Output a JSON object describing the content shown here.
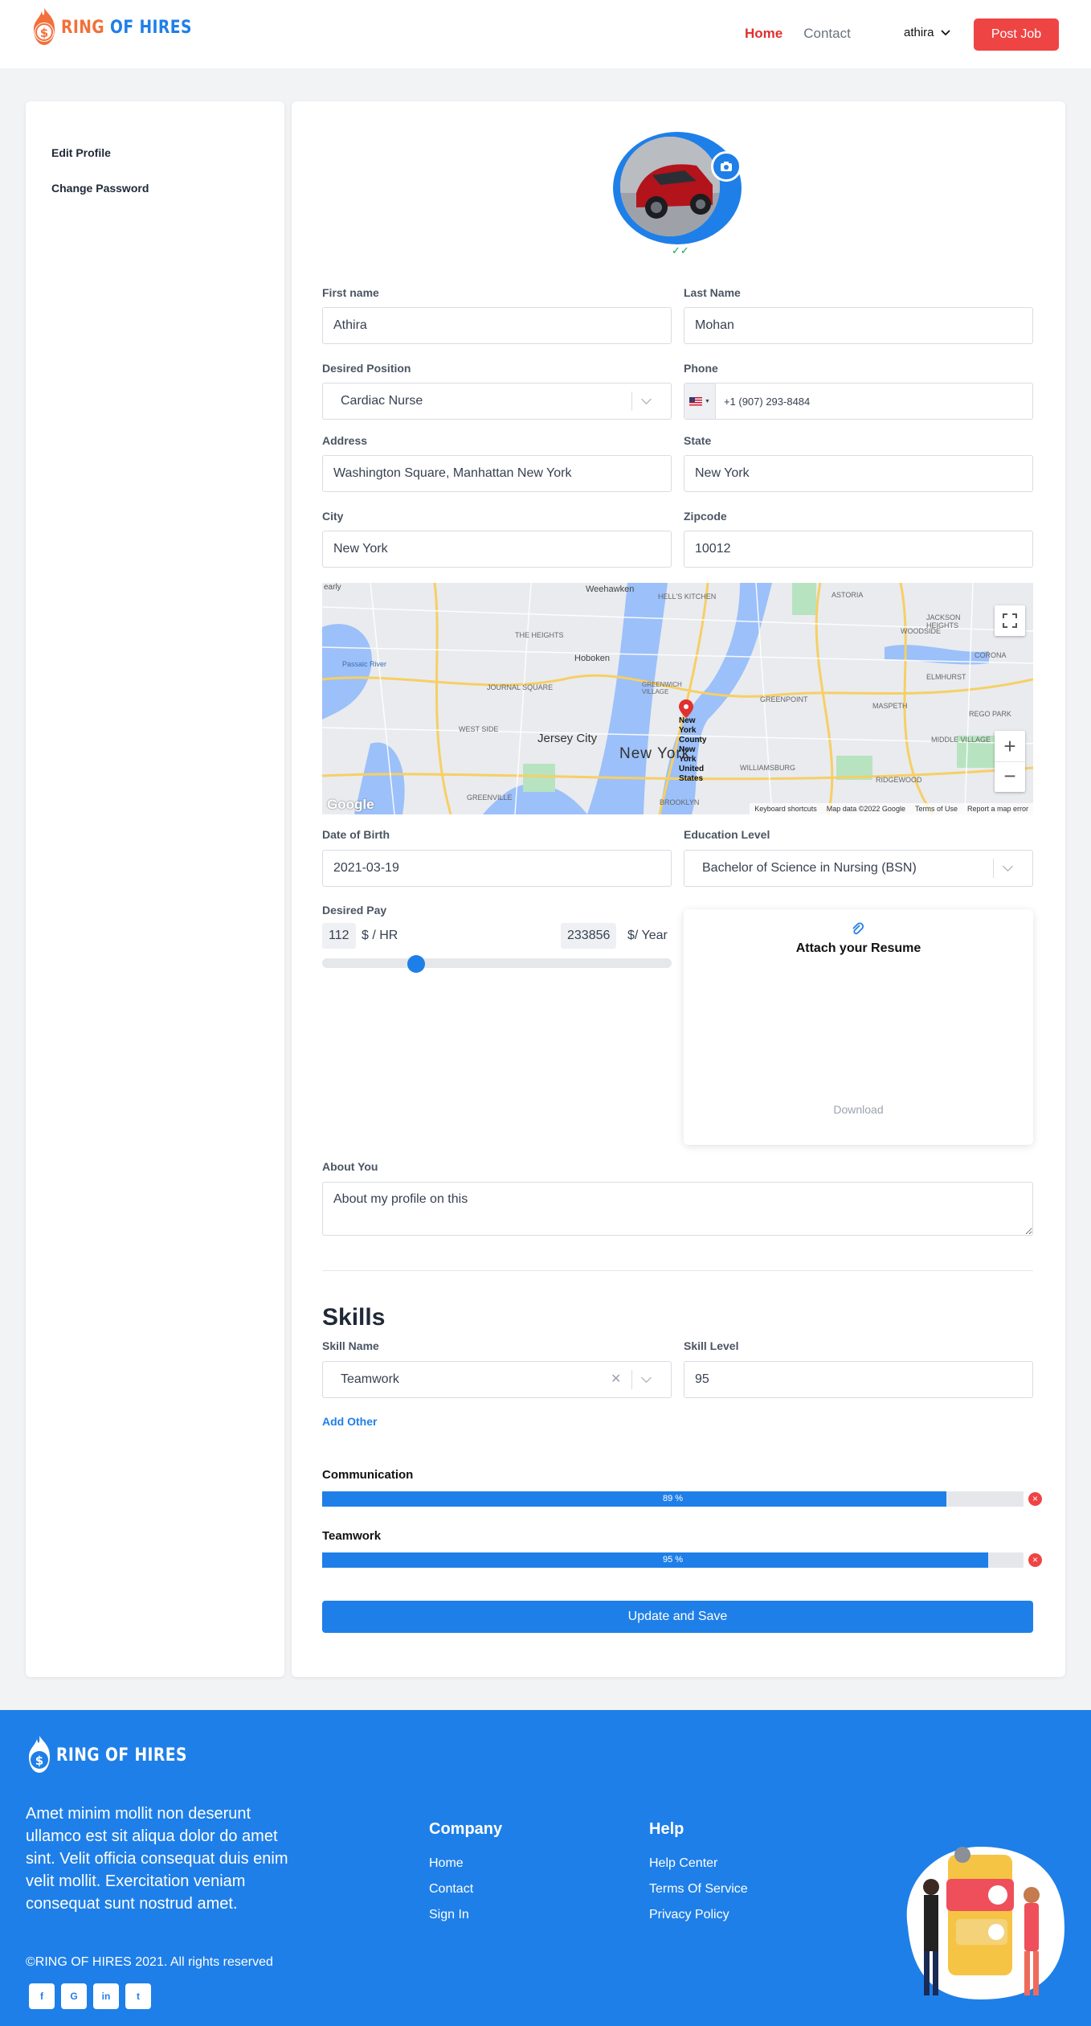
{
  "brand": {
    "name_part1": "RING",
    "name_part2": "OF HIRES"
  },
  "nav": {
    "home": "Home",
    "contact": "Contact",
    "user": "athira",
    "post_job": "Post Job"
  },
  "sidebar": {
    "items": [
      {
        "label": "Edit Profile"
      },
      {
        "label": "Change Password"
      }
    ]
  },
  "form": {
    "first_name": {
      "label": "First name",
      "value": "Athira"
    },
    "last_name": {
      "label": "Last Name",
      "value": "Mohan"
    },
    "position": {
      "label": "Desired Position",
      "value": "Cardiac Nurse"
    },
    "phone": {
      "label": "Phone",
      "value": "+1 (907) 293-8484"
    },
    "address": {
      "label": "Address",
      "value": "Washington Square, Manhattan New York"
    },
    "state": {
      "label": "State",
      "value": "New York"
    },
    "city": {
      "label": "City",
      "value": "New York"
    },
    "zipcode": {
      "label": "Zipcode",
      "value": "10012"
    },
    "dob": {
      "label": "Date of Birth",
      "value": "2021-03-19"
    },
    "education": {
      "label": "Education Level",
      "value": "Bachelor of Science in Nursing (BSN)"
    },
    "pay": {
      "label": "Desired Pay",
      "hourly": "112",
      "hourly_unit": "$ / HR",
      "yearly": "233856",
      "yearly_unit": "$/ Year",
      "slider_fraction": 0.27
    },
    "resume": {
      "title": "Attach your Resume",
      "download": "Download"
    },
    "about": {
      "label": "About You",
      "value": "About my profile on this"
    }
  },
  "map": {
    "labels": {
      "weehawken": "Weehawken",
      "hells_kitchen": "HELL'S KITCHEN",
      "astoria": "ASTORIA",
      "jackson_heights": "JACKSON HEIGHTS",
      "heights": "THE HEIGHTS",
      "hoboken": "Hoboken",
      "woodside": "WOODSIDE",
      "journal_square": "JOURNAL SQUARE",
      "greenwich": "GREENWICH VILLAGE",
      "greenpoint": "GREENPOINT",
      "elmhurst": "ELMHURST",
      "maspeth": "MASPETH",
      "corona": "CORONA",
      "rego_park": "REGO PARK",
      "west_side": "WEST SIDE",
      "jersey_city": "Jersey City",
      "new_york": "New York",
      "middle_village": "MIDDLE VILLAGE",
      "williamsburg": "WILLIAMSBURG",
      "ridgewood": "RIDGEWOOD",
      "greenville": "GREENVILLE",
      "brooklyn": "BROOKLYN",
      "pin_label": "New York County New York United States",
      "newark_bay": "Passaic River",
      "early": "early"
    },
    "google": "Google",
    "footer_links": [
      "Keyboard shortcuts",
      "Map data ©2022 Google",
      "Terms of Use",
      "Report a map error"
    ]
  },
  "skills": {
    "title": "Skills",
    "skill_name_label": "Skill Name",
    "skill_name_value": "Teamwork",
    "skill_level_label": "Skill Level",
    "skill_level_value": "95",
    "add_other": "Add Other",
    "list": [
      {
        "name": "Communication",
        "percent": 89,
        "label": "89 %"
      },
      {
        "name": "Teamwork",
        "percent": 95,
        "label": "95 %"
      }
    ]
  },
  "save_button": "Update and Save",
  "footer": {
    "description": "Amet minim mollit non deserunt ullamco est sit aliqua dolor do amet sint. Velit officia consequat duis enim velit mollit. Exercitation veniam consequat sunt nostrud amet.",
    "copyright": "©RING OF HIRES 2021. All rights reserved",
    "company": {
      "title": "Company",
      "links": [
        "Home",
        "Contact",
        "Sign In"
      ]
    },
    "help": {
      "title": "Help",
      "links": [
        "Help Center",
        "Terms Of Service",
        "Privacy Policy"
      ]
    },
    "social": [
      "facebook-icon",
      "google-icon",
      "linkedin-icon",
      "twitter-icon"
    ]
  },
  "colors": {
    "primary": "#1f7fe8",
    "accent": "#ef4444",
    "brand_orange": "#f2703a"
  }
}
